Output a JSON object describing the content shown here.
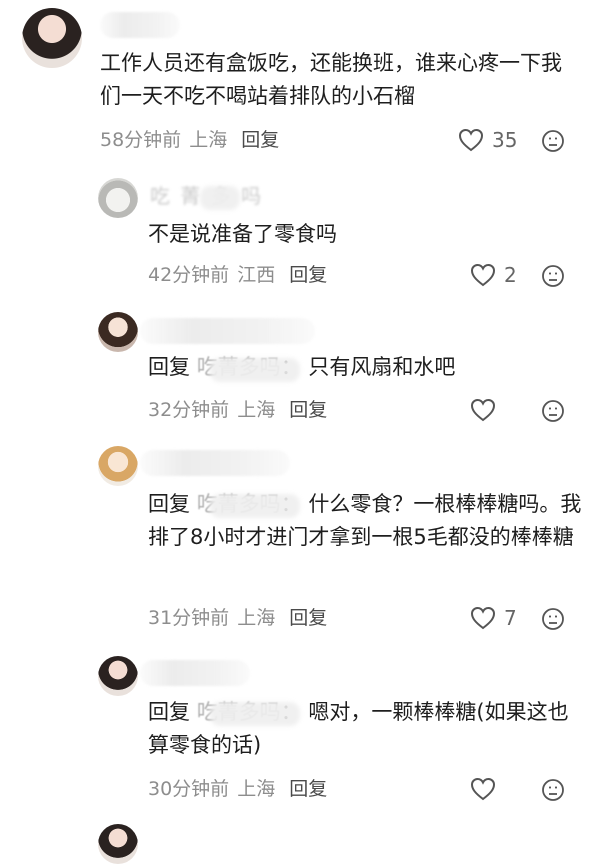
{
  "comments": [
    {
      "text": "工作人员还有盒饭吃，还能换班，谁来心疼一下我们一天不吃不喝站着排队的小石榴",
      "time": "58分钟前",
      "location": "上海",
      "reply_label": "回复",
      "likes": "35"
    }
  ],
  "replies": [
    {
      "name_partial": "吃 菁 多 吗",
      "text": "不是说准备了零食吗",
      "time": "42分钟前",
      "location": "江西",
      "reply_label": "回复",
      "likes": "2"
    },
    {
      "reply_prefix": "回复",
      "reply_target": "吃菁多吗",
      "text": "只有风扇和水吧",
      "time": "32分钟前",
      "location": "上海",
      "reply_label": "回复",
      "likes": ""
    },
    {
      "reply_prefix": "回复",
      "reply_target": "吃菁多吗",
      "text": "什么零食？一根棒棒糖吗。我排了8小时才进门才拿到一根5毛都没的棒棒糖",
      "time": "31分钟前",
      "location": "上海",
      "reply_label": "回复",
      "likes": "7"
    },
    {
      "reply_prefix": "回复",
      "reply_target": "吃菁多吗",
      "text": "嗯对，一颗棒棒糖(如果这也算零食的话)",
      "time": "30分钟前",
      "location": "上海",
      "reply_label": "回复",
      "likes": ""
    }
  ],
  "icons": {
    "like": "heart-outline-icon",
    "dislike": "frown-face-icon"
  },
  "colors": {
    "meta": "#8d8d8d",
    "text": "#1e1e1e"
  }
}
